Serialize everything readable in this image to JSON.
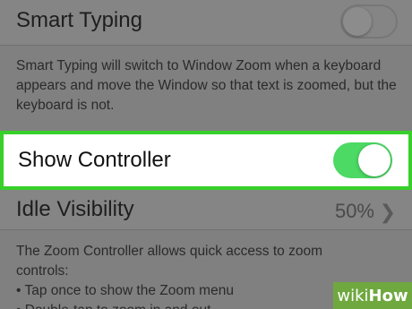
{
  "smart_typing": {
    "label": "Smart Typing",
    "enabled": false,
    "description": "Smart Typing will switch to Window Zoom when a keyboard appears and move the Window so that text is zoomed, but the keyboard is not."
  },
  "show_controller": {
    "label": "Show Controller",
    "enabled": true
  },
  "idle_visibility": {
    "label": "Idle Visibility",
    "value": "50%"
  },
  "controller_description": {
    "line1": "The Zoom Controller allows quick access to zoom",
    "line2": "controls:",
    "bullet1": "• Tap once to show the Zoom menu",
    "bullet2": "• Double-tap to zoom in and out"
  },
  "watermark": {
    "wiki": "wiki",
    "how": "How"
  },
  "colors": {
    "toggle_on": "#4cd964",
    "highlight_border": "#37d02a",
    "dim_background": "#808080"
  }
}
